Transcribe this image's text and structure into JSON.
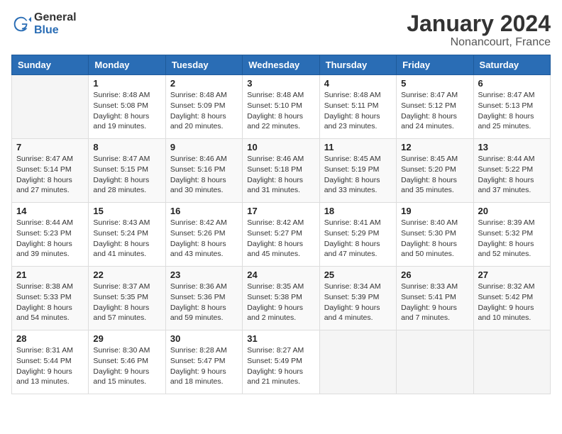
{
  "header": {
    "logo_general": "General",
    "logo_blue": "Blue",
    "month_title": "January 2024",
    "location": "Nonancourt, France"
  },
  "weekdays": [
    "Sunday",
    "Monday",
    "Tuesday",
    "Wednesday",
    "Thursday",
    "Friday",
    "Saturday"
  ],
  "weeks": [
    [
      {
        "day": "",
        "sunrise": "",
        "sunset": "",
        "daylight": ""
      },
      {
        "day": "1",
        "sunrise": "Sunrise: 8:48 AM",
        "sunset": "Sunset: 5:08 PM",
        "daylight": "Daylight: 8 hours and 19 minutes."
      },
      {
        "day": "2",
        "sunrise": "Sunrise: 8:48 AM",
        "sunset": "Sunset: 5:09 PM",
        "daylight": "Daylight: 8 hours and 20 minutes."
      },
      {
        "day": "3",
        "sunrise": "Sunrise: 8:48 AM",
        "sunset": "Sunset: 5:10 PM",
        "daylight": "Daylight: 8 hours and 22 minutes."
      },
      {
        "day": "4",
        "sunrise": "Sunrise: 8:48 AM",
        "sunset": "Sunset: 5:11 PM",
        "daylight": "Daylight: 8 hours and 23 minutes."
      },
      {
        "day": "5",
        "sunrise": "Sunrise: 8:47 AM",
        "sunset": "Sunset: 5:12 PM",
        "daylight": "Daylight: 8 hours and 24 minutes."
      },
      {
        "day": "6",
        "sunrise": "Sunrise: 8:47 AM",
        "sunset": "Sunset: 5:13 PM",
        "daylight": "Daylight: 8 hours and 25 minutes."
      }
    ],
    [
      {
        "day": "7",
        "sunrise": "Sunrise: 8:47 AM",
        "sunset": "Sunset: 5:14 PM",
        "daylight": "Daylight: 8 hours and 27 minutes."
      },
      {
        "day": "8",
        "sunrise": "Sunrise: 8:47 AM",
        "sunset": "Sunset: 5:15 PM",
        "daylight": "Daylight: 8 hours and 28 minutes."
      },
      {
        "day": "9",
        "sunrise": "Sunrise: 8:46 AM",
        "sunset": "Sunset: 5:16 PM",
        "daylight": "Daylight: 8 hours and 30 minutes."
      },
      {
        "day": "10",
        "sunrise": "Sunrise: 8:46 AM",
        "sunset": "Sunset: 5:18 PM",
        "daylight": "Daylight: 8 hours and 31 minutes."
      },
      {
        "day": "11",
        "sunrise": "Sunrise: 8:45 AM",
        "sunset": "Sunset: 5:19 PM",
        "daylight": "Daylight: 8 hours and 33 minutes."
      },
      {
        "day": "12",
        "sunrise": "Sunrise: 8:45 AM",
        "sunset": "Sunset: 5:20 PM",
        "daylight": "Daylight: 8 hours and 35 minutes."
      },
      {
        "day": "13",
        "sunrise": "Sunrise: 8:44 AM",
        "sunset": "Sunset: 5:22 PM",
        "daylight": "Daylight: 8 hours and 37 minutes."
      }
    ],
    [
      {
        "day": "14",
        "sunrise": "Sunrise: 8:44 AM",
        "sunset": "Sunset: 5:23 PM",
        "daylight": "Daylight: 8 hours and 39 minutes."
      },
      {
        "day": "15",
        "sunrise": "Sunrise: 8:43 AM",
        "sunset": "Sunset: 5:24 PM",
        "daylight": "Daylight: 8 hours and 41 minutes."
      },
      {
        "day": "16",
        "sunrise": "Sunrise: 8:42 AM",
        "sunset": "Sunset: 5:26 PM",
        "daylight": "Daylight: 8 hours and 43 minutes."
      },
      {
        "day": "17",
        "sunrise": "Sunrise: 8:42 AM",
        "sunset": "Sunset: 5:27 PM",
        "daylight": "Daylight: 8 hours and 45 minutes."
      },
      {
        "day": "18",
        "sunrise": "Sunrise: 8:41 AM",
        "sunset": "Sunset: 5:29 PM",
        "daylight": "Daylight: 8 hours and 47 minutes."
      },
      {
        "day": "19",
        "sunrise": "Sunrise: 8:40 AM",
        "sunset": "Sunset: 5:30 PM",
        "daylight": "Daylight: 8 hours and 50 minutes."
      },
      {
        "day": "20",
        "sunrise": "Sunrise: 8:39 AM",
        "sunset": "Sunset: 5:32 PM",
        "daylight": "Daylight: 8 hours and 52 minutes."
      }
    ],
    [
      {
        "day": "21",
        "sunrise": "Sunrise: 8:38 AM",
        "sunset": "Sunset: 5:33 PM",
        "daylight": "Daylight: 8 hours and 54 minutes."
      },
      {
        "day": "22",
        "sunrise": "Sunrise: 8:37 AM",
        "sunset": "Sunset: 5:35 PM",
        "daylight": "Daylight: 8 hours and 57 minutes."
      },
      {
        "day": "23",
        "sunrise": "Sunrise: 8:36 AM",
        "sunset": "Sunset: 5:36 PM",
        "daylight": "Daylight: 8 hours and 59 minutes."
      },
      {
        "day": "24",
        "sunrise": "Sunrise: 8:35 AM",
        "sunset": "Sunset: 5:38 PM",
        "daylight": "Daylight: 9 hours and 2 minutes."
      },
      {
        "day": "25",
        "sunrise": "Sunrise: 8:34 AM",
        "sunset": "Sunset: 5:39 PM",
        "daylight": "Daylight: 9 hours and 4 minutes."
      },
      {
        "day": "26",
        "sunrise": "Sunrise: 8:33 AM",
        "sunset": "Sunset: 5:41 PM",
        "daylight": "Daylight: 9 hours and 7 minutes."
      },
      {
        "day": "27",
        "sunrise": "Sunrise: 8:32 AM",
        "sunset": "Sunset: 5:42 PM",
        "daylight": "Daylight: 9 hours and 10 minutes."
      }
    ],
    [
      {
        "day": "28",
        "sunrise": "Sunrise: 8:31 AM",
        "sunset": "Sunset: 5:44 PM",
        "daylight": "Daylight: 9 hours and 13 minutes."
      },
      {
        "day": "29",
        "sunrise": "Sunrise: 8:30 AM",
        "sunset": "Sunset: 5:46 PM",
        "daylight": "Daylight: 9 hours and 15 minutes."
      },
      {
        "day": "30",
        "sunrise": "Sunrise: 8:28 AM",
        "sunset": "Sunset: 5:47 PM",
        "daylight": "Daylight: 9 hours and 18 minutes."
      },
      {
        "day": "31",
        "sunrise": "Sunrise: 8:27 AM",
        "sunset": "Sunset: 5:49 PM",
        "daylight": "Daylight: 9 hours and 21 minutes."
      },
      {
        "day": "",
        "sunrise": "",
        "sunset": "",
        "daylight": ""
      },
      {
        "day": "",
        "sunrise": "",
        "sunset": "",
        "daylight": ""
      },
      {
        "day": "",
        "sunrise": "",
        "sunset": "",
        "daylight": ""
      }
    ]
  ]
}
